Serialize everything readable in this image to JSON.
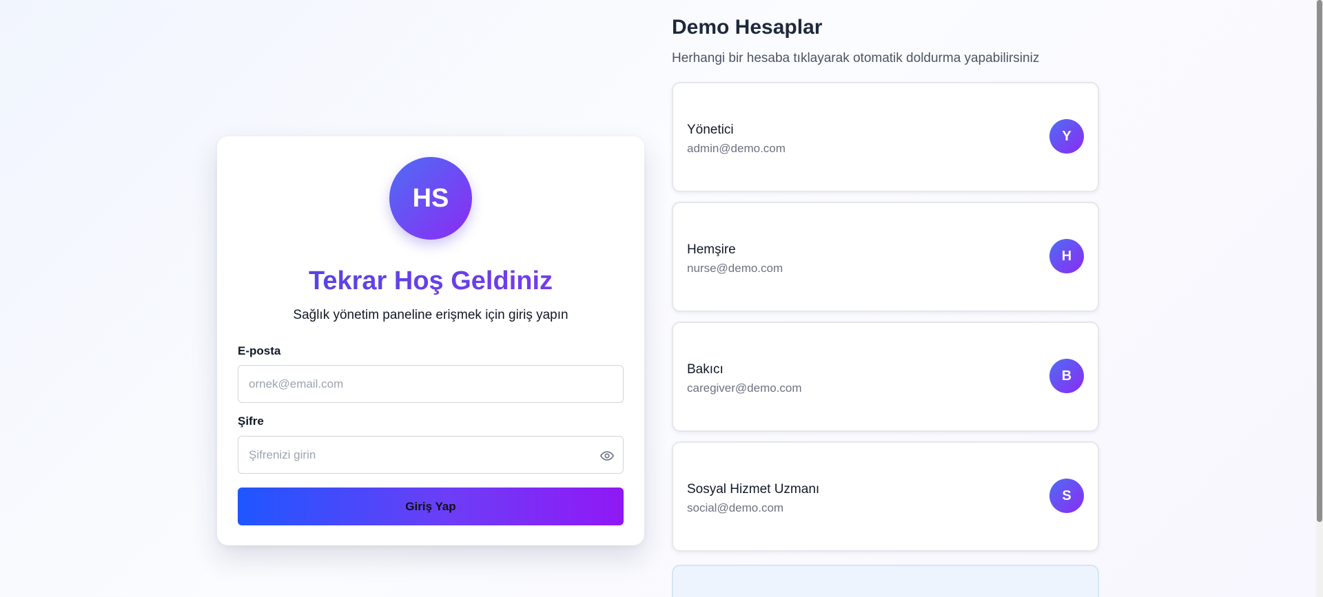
{
  "login": {
    "logo_text": "HS",
    "title": "Tekrar Hoş Geldiniz",
    "subtitle": "Sağlık yönetim paneline erişmek için giriş yapın",
    "email_label": "E-posta",
    "email_placeholder": "ornek@email.com",
    "email_value": "",
    "password_label": "Şifre",
    "password_placeholder": "Şifrenizi girin",
    "password_value": "",
    "submit_label": "Giriş Yap"
  },
  "demo": {
    "title": "Demo Hesaplar",
    "subtitle": "Herhangi bir hesaba tıklayarak otomatik doldurma yapabilirsiniz",
    "accounts": [
      {
        "name": "Yönetici",
        "email": "admin@demo.com",
        "initial": "Y"
      },
      {
        "name": "Hemşire",
        "email": "nurse@demo.com",
        "initial": "H"
      },
      {
        "name": "Bakıcı",
        "email": "caregiver@demo.com",
        "initial": "B"
      },
      {
        "name": "Sosyal Hizmet Uzmanı",
        "email": "social@demo.com",
        "initial": "S"
      }
    ]
  },
  "icons": {
    "password_toggle": "eye-icon"
  },
  "colors": {
    "accent_start": "#1f56ff",
    "accent_end": "#9018f5",
    "title_gradient_start": "#4f46e5",
    "title_gradient_end": "#7c3aed"
  }
}
